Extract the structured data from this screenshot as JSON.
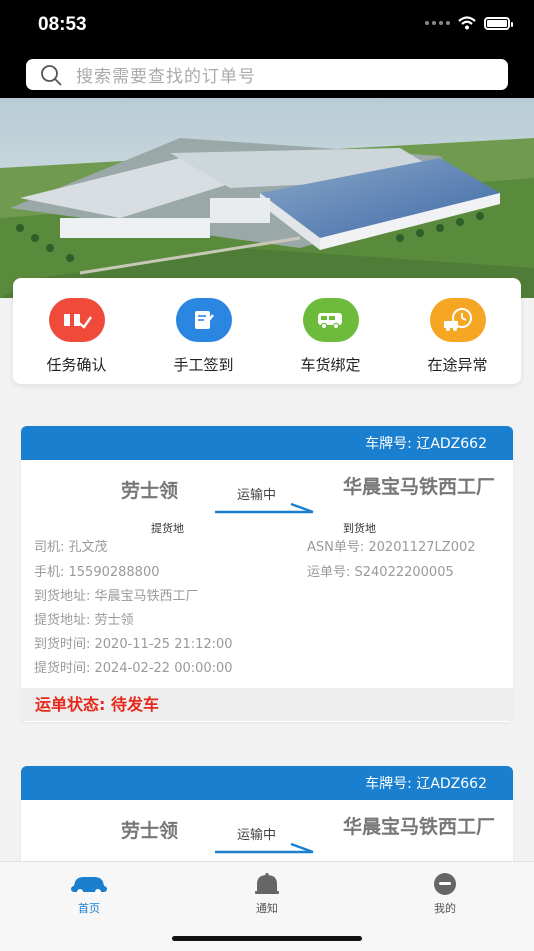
{
  "status_bar": {
    "time": "08:53"
  },
  "search": {
    "placeholder": "搜索需要查找的订单号"
  },
  "quick_actions": [
    {
      "label": "任务确认",
      "icon": "package-confirm-icon",
      "color": "#ef4a3a"
    },
    {
      "label": "手工签到",
      "icon": "sign-in-icon",
      "color": "#2a86e0"
    },
    {
      "label": "车货绑定",
      "icon": "van-icon",
      "color": "#6dbb3a"
    },
    {
      "label": "在途异常",
      "icon": "truck-clock-icon",
      "color": "#f5a623"
    }
  ],
  "orders": [
    {
      "plate": "车牌号: 辽ADZ662",
      "from": "劳士领",
      "from_sub": "提货地",
      "transit": "运输中",
      "to": "华晨宝马铁西工厂",
      "to_sub": "到货地",
      "driver": "司机: 孔文茂",
      "phone": "手机: 15590288800",
      "asn": "ASN单号: 20201127LZ002",
      "waybill": "运单号: S24022200005",
      "dest_addr": "到货地址: 华晨宝马铁西工厂",
      "pickup_addr": "提货地址: 劳士领",
      "arrival_time": "到货时间: 2020-11-25 21:12:00",
      "pickup_time": "提货时间: 2024-02-22 00:00:00",
      "status": "运单状态: 待发车"
    },
    {
      "plate": "车牌号: 辽ADZ662",
      "from": "劳士领",
      "from_sub": "",
      "transit": "运输中",
      "to": "华晨宝马铁西工厂",
      "to_sub": ""
    }
  ],
  "tabbar": [
    {
      "label": "首页",
      "icon": "car-icon",
      "active": true
    },
    {
      "label": "通知",
      "icon": "bell-icon",
      "active": false
    },
    {
      "label": "我的",
      "icon": "profile-icon",
      "active": false
    }
  ],
  "colors": {
    "primary": "#1a7fce",
    "status_red": "#e8281d"
  }
}
